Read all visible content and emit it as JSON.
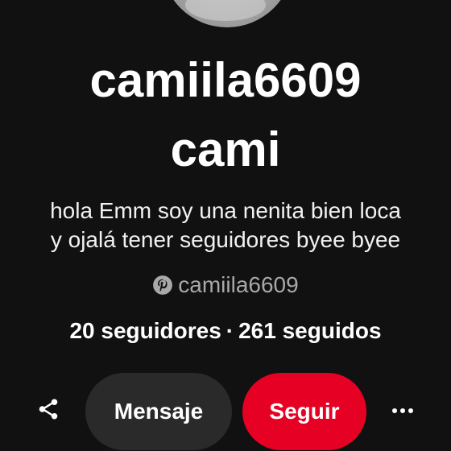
{
  "profile": {
    "username": "camiila6609",
    "display_name": "cami",
    "bio_line1": "hola Emm soy una nenita bien loca",
    "bio_line2": "y ojalá tener seguidores byee byee",
    "handle": "camiila6609",
    "followers": "20 seguidores",
    "separator": "·",
    "following": "261 seguidos"
  },
  "actions": {
    "share_icon": "share-icon",
    "message_label": "Mensaje",
    "follow_label": "Seguir",
    "more_icon": "more-horizontal-icon"
  },
  "colors": {
    "background": "#111111",
    "follow_button": "#e60023",
    "message_button": "#2a2a2a",
    "handle_text": "#a9a9a9"
  }
}
